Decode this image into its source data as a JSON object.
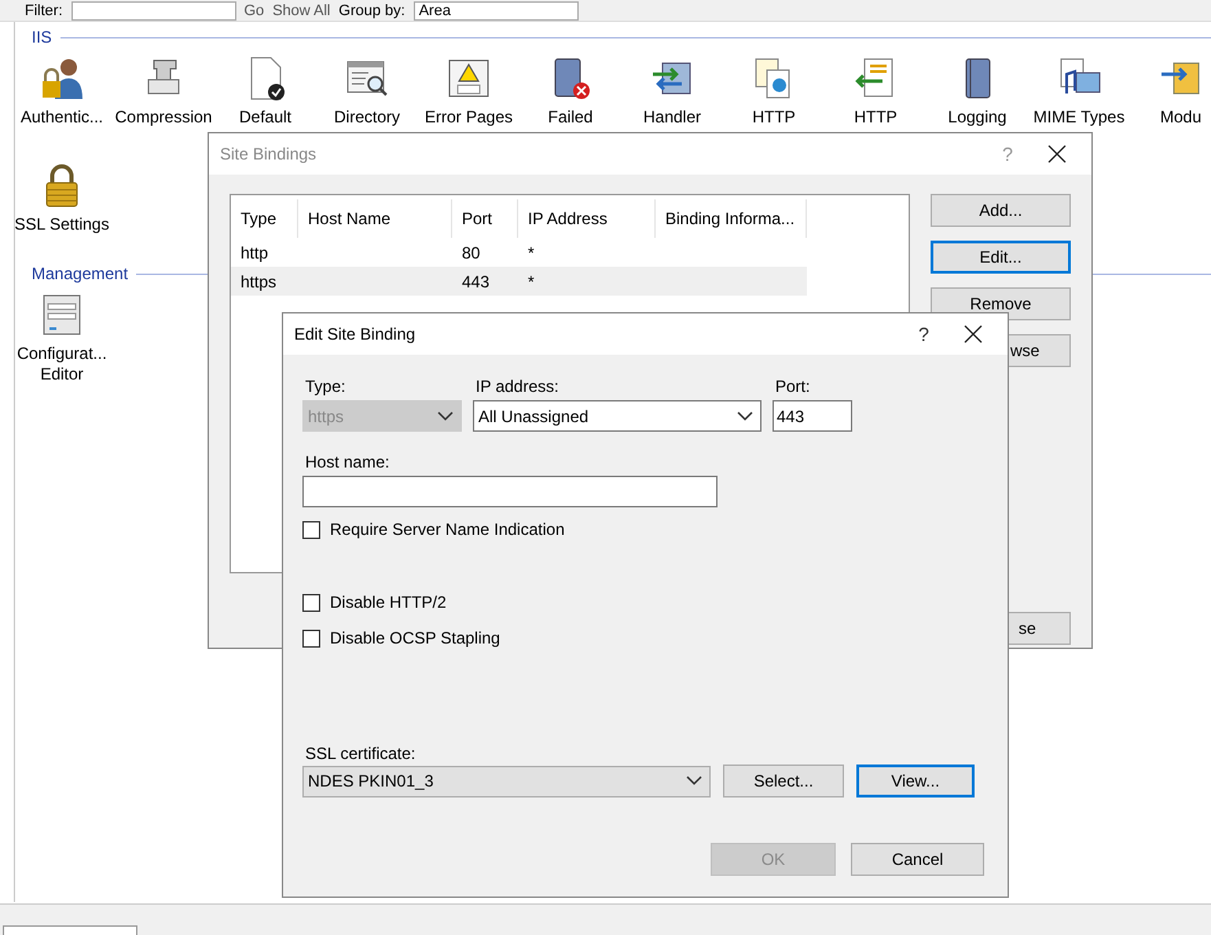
{
  "toolbar": {
    "filter_label": "Filter:",
    "go_button": "Go",
    "show_all_button": "Show All",
    "group_by_label": "Group by:",
    "group_by_value": "Area"
  },
  "groups": [
    {
      "title": "IIS",
      "rows": [
        [
          {
            "label": "Authentic..."
          },
          {
            "label": "Compression"
          },
          {
            "label": "Default"
          },
          {
            "label": "Directory"
          },
          {
            "label": "Error Pages"
          },
          {
            "label": "Failed"
          },
          {
            "label": "Handler"
          },
          {
            "label": "HTTP"
          },
          {
            "label": "HTTP"
          },
          {
            "label": "Logging"
          },
          {
            "label": "MIME Types"
          },
          {
            "label": "Modu"
          }
        ],
        [
          {
            "label": "SSL Settings"
          }
        ]
      ]
    },
    {
      "title": "Management",
      "rows": [
        [
          {
            "label": "Configurat... Editor"
          }
        ]
      ]
    }
  ],
  "site_bindings": {
    "title": "Site Bindings",
    "help": "?",
    "columns": [
      "Type",
      "Host Name",
      "Port",
      "IP Address",
      "Binding Informa..."
    ],
    "rows": [
      {
        "type": "http",
        "host_name": "",
        "port": "80",
        "ip_address": "*",
        "selected": false
      },
      {
        "type": "https",
        "host_name": "",
        "port": "443",
        "ip_address": "*",
        "selected": true
      }
    ],
    "buttons": [
      {
        "label": "Add...",
        "kind": "button",
        "focused": false
      },
      {
        "label": "Edit...",
        "kind": "button",
        "focused": true
      },
      {
        "label": "Remove",
        "kind": "button",
        "focused": false
      },
      {
        "label": "wse",
        "kind": "partly_hidden",
        "focused": false
      },
      {
        "label": "se",
        "kind": "partly_hidden_bottom",
        "focused": false
      }
    ]
  },
  "edit_binding": {
    "title": "Edit Site Binding",
    "help": "?",
    "type": {
      "label": "Type:",
      "value": "https",
      "disabled": true
    },
    "ip_address": {
      "label": "IP address:",
      "value": "All Unassigned"
    },
    "port": {
      "label": "Port:",
      "value": "443"
    },
    "host_name": {
      "label": "Host name:"
    },
    "checkboxes": [
      {
        "label": "Require Server Name Indication",
        "checked": false
      },
      {
        "label": "Disable HTTP/2",
        "checked": false
      },
      {
        "label": "Disable OCSP Stapling",
        "checked": false
      }
    ],
    "ssl_certificate": {
      "label": "SSL certificate:",
      "value": "NDES PKIN01_3"
    },
    "select_button": {
      "label": "Select...",
      "focused": false
    },
    "view_button": {
      "label": "View...",
      "focused": true
    },
    "ok_button": {
      "label": "OK",
      "disabled": true
    },
    "cancel_button": {
      "label": "Cancel",
      "disabled": false
    }
  }
}
